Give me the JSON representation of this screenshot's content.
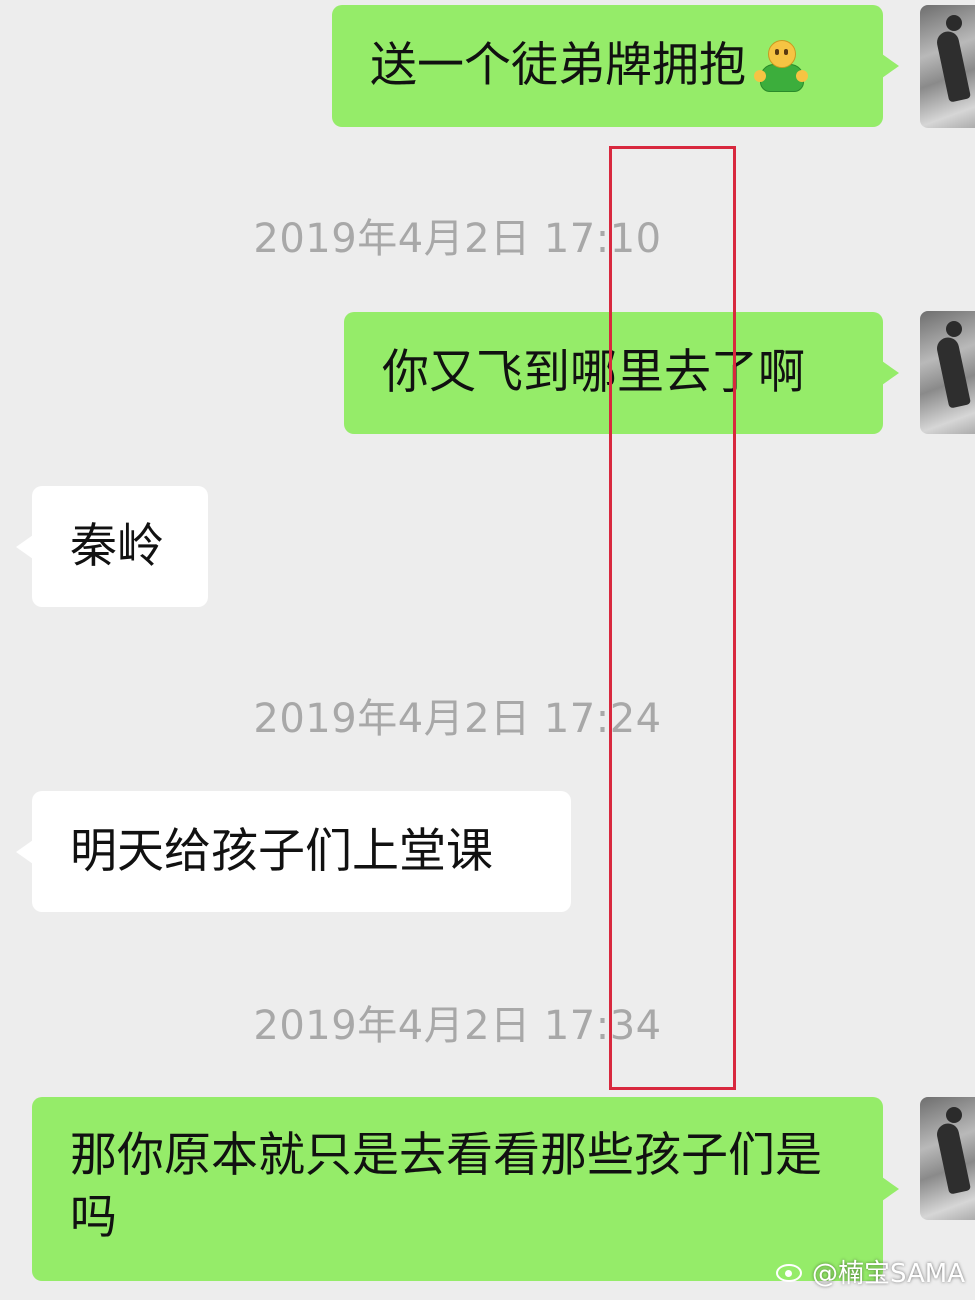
{
  "chat": {
    "messages": [
      {
        "role": "sent",
        "text": "送一个徒弟牌拥抱",
        "emoji": "hugging-person-emoji"
      },
      {
        "role": "timestamp",
        "text": "2019年4月2日 17:10"
      },
      {
        "role": "sent",
        "text": "你又飞到哪里去了啊"
      },
      {
        "role": "received",
        "text": "秦岭"
      },
      {
        "role": "timestamp",
        "text": "2019年4月2日 17:24"
      },
      {
        "role": "received",
        "text": "明天给孩子们上堂课"
      },
      {
        "role": "timestamp",
        "text": "2019年4月2日 17:34"
      },
      {
        "role": "sent",
        "text": "那你原本就只是去看看那些孩子们是吗"
      }
    ]
  },
  "watermark": {
    "icon": "weibo-logo-icon",
    "text": "@楠宝SAMA"
  },
  "colors": {
    "background": "#ededed",
    "sent_bubble": "#95ec69",
    "received_bubble": "#ffffff",
    "timestamp_text": "#a8a8a8",
    "highlight_box": "#d8283e"
  }
}
